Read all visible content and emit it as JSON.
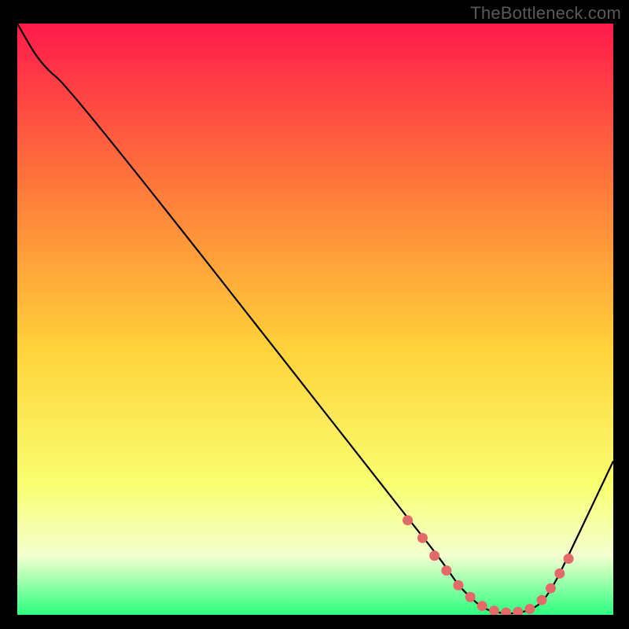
{
  "watermark": "TheBottleneck.com",
  "colors": {
    "page_bg": "#000000",
    "gradient_top": "#ff1a4b",
    "gradient_mid_upper": "#ff7a3a",
    "gradient_mid": "#ffd23a",
    "gradient_lower": "#f9ff70",
    "gradient_pale": "#f4ffd0",
    "gradient_bottom": "#2bff7e",
    "curve": "#000000",
    "marker_fill": "#e46a6a",
    "marker_stroke": "#8a2f2f"
  },
  "chart_data": {
    "type": "line",
    "title": "",
    "xlabel": "",
    "ylabel": "",
    "xlim": [
      0,
      100
    ],
    "ylim": [
      0,
      100
    ],
    "x": [
      0,
      4,
      9,
      65,
      69,
      72,
      74,
      76,
      78,
      80,
      82,
      84,
      86,
      88,
      90,
      92,
      100
    ],
    "y": [
      100,
      93,
      89,
      17,
      12,
      8,
      5,
      3,
      1.2,
      0.5,
      0.2,
      0.3,
      0.8,
      2,
      5,
      9,
      26
    ],
    "markers": {
      "x": [
        65.5,
        68,
        70,
        72,
        74,
        76,
        78,
        80,
        82,
        84,
        86,
        88,
        89.5,
        91,
        92.5
      ],
      "y": [
        16,
        13,
        10,
        7.5,
        5,
        3,
        1.5,
        0.7,
        0.4,
        0.5,
        1,
        2.5,
        4.5,
        7,
        9.5
      ]
    }
  }
}
